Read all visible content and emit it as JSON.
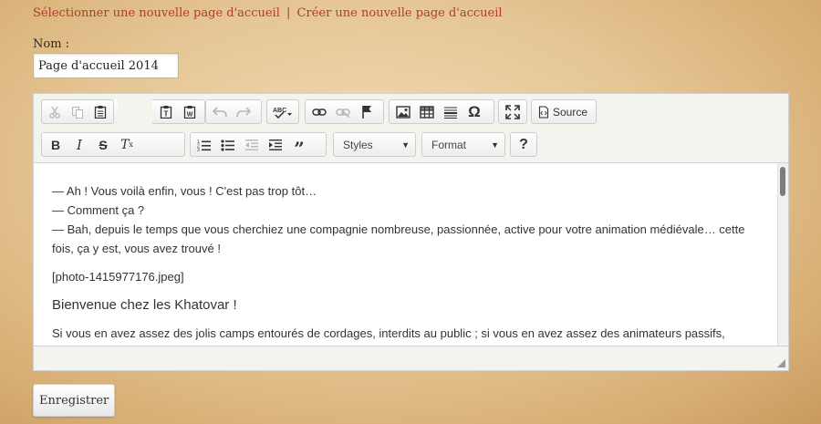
{
  "topnav": {
    "select_link": "Sélectionner une nouvelle page d'accueil",
    "separator": "|",
    "create_link": "Créer une nouvelle page d'accueil"
  },
  "form": {
    "name_label": "Nom :",
    "name_value": "Page d'accueil 2014",
    "save_label": "Enregistrer"
  },
  "editor": {
    "toolbar_row1": [
      {
        "icon": "cut-icon",
        "enabled": false
      },
      {
        "icon": "copy-icon",
        "enabled": false
      },
      {
        "icon": "paste-icon",
        "enabled": true
      },
      {
        "icon": "paste-text-icon",
        "enabled": true
      },
      {
        "icon": "paste-word-icon",
        "enabled": true
      },
      {
        "icon": "undo-icon",
        "enabled": false
      },
      {
        "icon": "redo-icon",
        "enabled": false
      },
      {
        "icon": "spellcheck-icon",
        "enabled": true
      },
      {
        "icon": "link-icon",
        "enabled": true
      },
      {
        "icon": "unlink-icon",
        "enabled": false
      },
      {
        "icon": "anchor-icon",
        "enabled": true
      },
      {
        "icon": "image-icon",
        "enabled": true
      },
      {
        "icon": "table-icon",
        "enabled": true
      },
      {
        "icon": "horizontal-rule-icon",
        "enabled": true
      },
      {
        "icon": "special-char-icon",
        "enabled": true
      },
      {
        "icon": "maximize-icon",
        "enabled": true
      }
    ],
    "source_label": "Source",
    "toolbar_row2": [
      {
        "icon": "bold-icon"
      },
      {
        "icon": "italic-icon"
      },
      {
        "icon": "strike-icon"
      },
      {
        "icon": "remove-format-icon"
      },
      {
        "icon": "numbered-list-icon"
      },
      {
        "icon": "bulleted-list-icon"
      },
      {
        "icon": "outdent-icon"
      },
      {
        "icon": "indent-icon"
      },
      {
        "icon": "blockquote-icon"
      }
    ],
    "styles_label": "Styles",
    "format_label": "Format",
    "help_label": "?",
    "content": {
      "line1": "— Ah ! Vous voilà enfin, vous ! C'est pas trop tôt…",
      "line2": "— Comment ça ?",
      "line3": "— Bah, depuis le temps que vous cherchiez une compagnie nombreuse, passionnée, active pour votre animation médiévale… cette fois, ça y est, vous avez trouvé !",
      "photo": "[photo-1415977176.jpeg]",
      "heading": "Bienvenue chez les Khatovar !",
      "para": "Si vous en avez assez des jolis camps entourés de cordages, interdits au public ; si vous en avez assez des animateurs passifs,"
    }
  }
}
